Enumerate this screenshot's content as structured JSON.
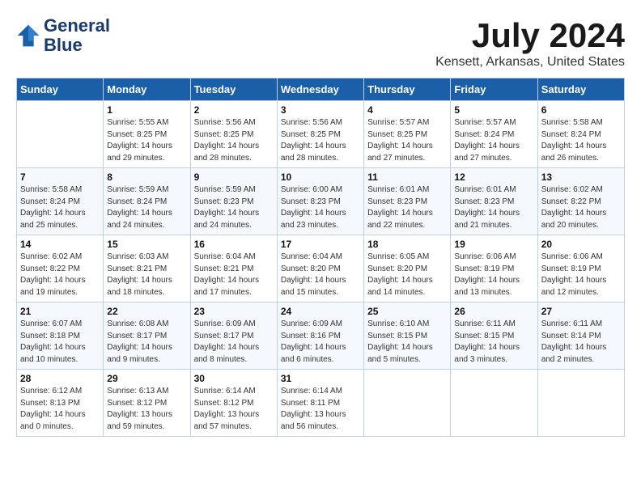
{
  "header": {
    "logo_line1": "General",
    "logo_line2": "Blue",
    "month_title": "July 2024",
    "location": "Kensett, Arkansas, United States"
  },
  "days_of_week": [
    "Sunday",
    "Monday",
    "Tuesday",
    "Wednesday",
    "Thursday",
    "Friday",
    "Saturday"
  ],
  "weeks": [
    [
      {
        "day": "",
        "info": ""
      },
      {
        "day": "1",
        "info": "Sunrise: 5:55 AM\nSunset: 8:25 PM\nDaylight: 14 hours\nand 29 minutes."
      },
      {
        "day": "2",
        "info": "Sunrise: 5:56 AM\nSunset: 8:25 PM\nDaylight: 14 hours\nand 28 minutes."
      },
      {
        "day": "3",
        "info": "Sunrise: 5:56 AM\nSunset: 8:25 PM\nDaylight: 14 hours\nand 28 minutes."
      },
      {
        "day": "4",
        "info": "Sunrise: 5:57 AM\nSunset: 8:25 PM\nDaylight: 14 hours\nand 27 minutes."
      },
      {
        "day": "5",
        "info": "Sunrise: 5:57 AM\nSunset: 8:24 PM\nDaylight: 14 hours\nand 27 minutes."
      },
      {
        "day": "6",
        "info": "Sunrise: 5:58 AM\nSunset: 8:24 PM\nDaylight: 14 hours\nand 26 minutes."
      }
    ],
    [
      {
        "day": "7",
        "info": "Sunrise: 5:58 AM\nSunset: 8:24 PM\nDaylight: 14 hours\nand 25 minutes."
      },
      {
        "day": "8",
        "info": "Sunrise: 5:59 AM\nSunset: 8:24 PM\nDaylight: 14 hours\nand 24 minutes."
      },
      {
        "day": "9",
        "info": "Sunrise: 5:59 AM\nSunset: 8:23 PM\nDaylight: 14 hours\nand 24 minutes."
      },
      {
        "day": "10",
        "info": "Sunrise: 6:00 AM\nSunset: 8:23 PM\nDaylight: 14 hours\nand 23 minutes."
      },
      {
        "day": "11",
        "info": "Sunrise: 6:01 AM\nSunset: 8:23 PM\nDaylight: 14 hours\nand 22 minutes."
      },
      {
        "day": "12",
        "info": "Sunrise: 6:01 AM\nSunset: 8:23 PM\nDaylight: 14 hours\nand 21 minutes."
      },
      {
        "day": "13",
        "info": "Sunrise: 6:02 AM\nSunset: 8:22 PM\nDaylight: 14 hours\nand 20 minutes."
      }
    ],
    [
      {
        "day": "14",
        "info": "Sunrise: 6:02 AM\nSunset: 8:22 PM\nDaylight: 14 hours\nand 19 minutes."
      },
      {
        "day": "15",
        "info": "Sunrise: 6:03 AM\nSunset: 8:21 PM\nDaylight: 14 hours\nand 18 minutes."
      },
      {
        "day": "16",
        "info": "Sunrise: 6:04 AM\nSunset: 8:21 PM\nDaylight: 14 hours\nand 17 minutes."
      },
      {
        "day": "17",
        "info": "Sunrise: 6:04 AM\nSunset: 8:20 PM\nDaylight: 14 hours\nand 15 minutes."
      },
      {
        "day": "18",
        "info": "Sunrise: 6:05 AM\nSunset: 8:20 PM\nDaylight: 14 hours\nand 14 minutes."
      },
      {
        "day": "19",
        "info": "Sunrise: 6:06 AM\nSunset: 8:19 PM\nDaylight: 14 hours\nand 13 minutes."
      },
      {
        "day": "20",
        "info": "Sunrise: 6:06 AM\nSunset: 8:19 PM\nDaylight: 14 hours\nand 12 minutes."
      }
    ],
    [
      {
        "day": "21",
        "info": "Sunrise: 6:07 AM\nSunset: 8:18 PM\nDaylight: 14 hours\nand 10 minutes."
      },
      {
        "day": "22",
        "info": "Sunrise: 6:08 AM\nSunset: 8:17 PM\nDaylight: 14 hours\nand 9 minutes."
      },
      {
        "day": "23",
        "info": "Sunrise: 6:09 AM\nSunset: 8:17 PM\nDaylight: 14 hours\nand 8 minutes."
      },
      {
        "day": "24",
        "info": "Sunrise: 6:09 AM\nSunset: 8:16 PM\nDaylight: 14 hours\nand 6 minutes."
      },
      {
        "day": "25",
        "info": "Sunrise: 6:10 AM\nSunset: 8:15 PM\nDaylight: 14 hours\nand 5 minutes."
      },
      {
        "day": "26",
        "info": "Sunrise: 6:11 AM\nSunset: 8:15 PM\nDaylight: 14 hours\nand 3 minutes."
      },
      {
        "day": "27",
        "info": "Sunrise: 6:11 AM\nSunset: 8:14 PM\nDaylight: 14 hours\nand 2 minutes."
      }
    ],
    [
      {
        "day": "28",
        "info": "Sunrise: 6:12 AM\nSunset: 8:13 PM\nDaylight: 14 hours\nand 0 minutes."
      },
      {
        "day": "29",
        "info": "Sunrise: 6:13 AM\nSunset: 8:12 PM\nDaylight: 13 hours\nand 59 minutes."
      },
      {
        "day": "30",
        "info": "Sunrise: 6:14 AM\nSunset: 8:12 PM\nDaylight: 13 hours\nand 57 minutes."
      },
      {
        "day": "31",
        "info": "Sunrise: 6:14 AM\nSunset: 8:11 PM\nDaylight: 13 hours\nand 56 minutes."
      },
      {
        "day": "",
        "info": ""
      },
      {
        "day": "",
        "info": ""
      },
      {
        "day": "",
        "info": ""
      }
    ]
  ]
}
